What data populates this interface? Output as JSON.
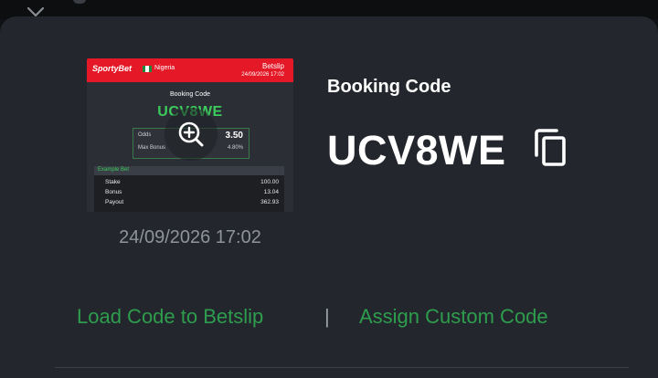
{
  "thumbnail": {
    "brand": "SportyBet",
    "country": "Nigeria",
    "slip_title": "Betslip",
    "slip_date": "24/09/2026 17:02",
    "booking_code_label": "Booking Code",
    "booking_code": "UCV8WE",
    "odds_label": "Odds",
    "odds_value": "3.50",
    "max_bonus_label": "Max Bonus",
    "max_bonus_value": "4.80%",
    "example_title": "Example Bet",
    "rows": [
      {
        "label": "Stake",
        "value": "100.00"
      },
      {
        "label": "Bonus",
        "value": "13.04"
      },
      {
        "label": "Payout",
        "value": "362.93"
      }
    ]
  },
  "timestamp": "24/09/2026 17:02",
  "booking": {
    "heading": "Booking Code",
    "code": "UCV8WE"
  },
  "actions": {
    "load_label": "Load Code to Betslip",
    "separator": "|",
    "assign_label": "Assign Custom Code"
  },
  "colors": {
    "accent_green": "#2e9d4e",
    "brand_red": "#e41827",
    "sheet_bg": "#23262c"
  },
  "icons": [
    "chevron-down-icon",
    "zoom-in-icon",
    "copy-icon"
  ]
}
